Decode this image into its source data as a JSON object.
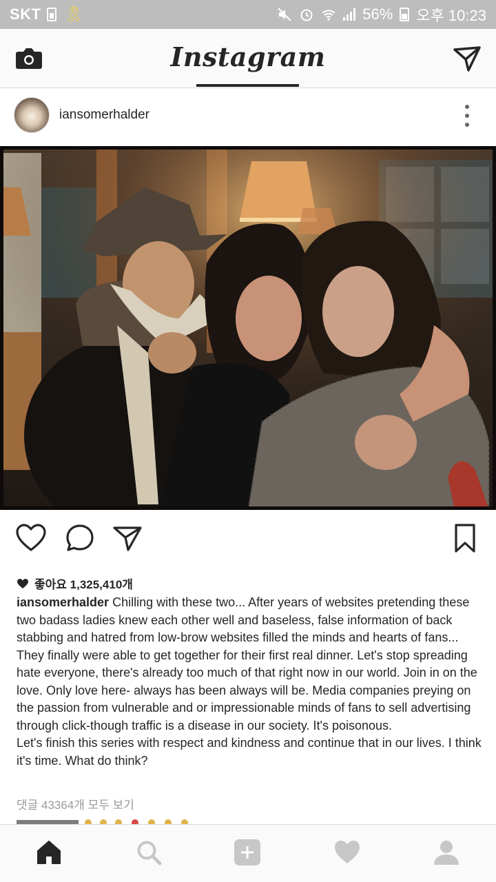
{
  "status_bar": {
    "carrier": "SKT",
    "battery": "56%",
    "time": "오후 10:23",
    "icons": [
      "sim-icon",
      "ribbon-icon",
      "mute-icon",
      "alarm-icon",
      "wifi-icon",
      "signal-icon",
      "battery-icon"
    ]
  },
  "header": {
    "title": "Instagram",
    "left_icon": "camera-icon",
    "right_icon": "direct-send-icon"
  },
  "post": {
    "username": "iansomerhalder",
    "more_icon": "more-vertical-icon",
    "likes_text": "좋아요 1,325,410개",
    "caption_user": "iansomerhalder",
    "caption_text": " Chilling with these two... After years of websites pretending these two badass ladies knew each other well and baseless, false information of back stabbing and hatred from low-brow websites filled the minds and hearts of fans... They finally were able to get together for their first real dinner. Let's stop spreading hate everyone, there's already too much of that right now in our world. Join in on the love. Only love here- always has been always will be. Media companies preying on the passion from vulnerable and or impressionable minds of fans to sell advertising through click-though traffic is a disease in our society. It's poisonous.\nLet's finish this series with respect and kindness and continue that in our lives. I think it's time. What do think?",
    "comments_link": "댓글 43364개 모두 보기"
  },
  "actions": [
    "heart-icon",
    "comment-icon",
    "share-icon",
    "bookmark-icon"
  ],
  "bottom_nav": [
    "home-icon",
    "search-icon",
    "add-icon",
    "activity-heart-icon",
    "profile-icon"
  ],
  "colors": {
    "status_bar_bg": "#bdbdbd",
    "text": "#262626",
    "muted": "#999999",
    "nav_inactive": "#c7c7c7"
  }
}
